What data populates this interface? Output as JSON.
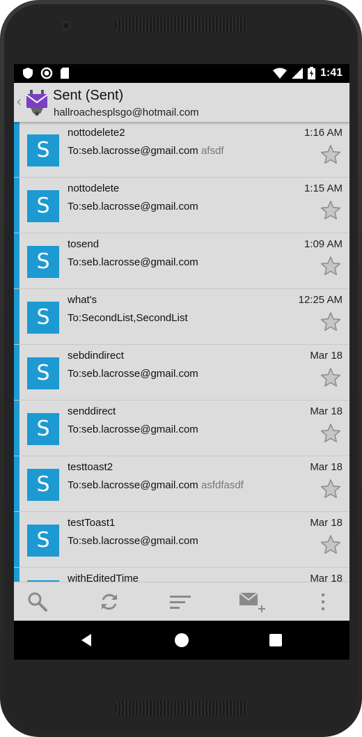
{
  "status_bar": {
    "time": "1:41"
  },
  "app_bar": {
    "title": "Sent (Sent)",
    "account": "hallroachesplsgo@hotmail.com"
  },
  "colors": {
    "accent": "#1d9ad1",
    "list_bg": "#dcdcdc"
  },
  "messages": [
    {
      "avatar": "S",
      "subject": "nottodelete2",
      "to": "To:seb.lacrosse@gmail.com",
      "snippet": "afsdf",
      "time": "1:16 AM",
      "starred": false
    },
    {
      "avatar": "S",
      "subject": "nottodelete",
      "to": "To:seb.lacrosse@gmail.com",
      "snippet": "",
      "time": "1:15 AM",
      "starred": false
    },
    {
      "avatar": "S",
      "subject": "tosend",
      "to": "To:seb.lacrosse@gmail.com",
      "snippet": "",
      "time": "1:09 AM",
      "starred": false
    },
    {
      "avatar": "S",
      "subject": "what's",
      "to": "To:SecondList,SecondList",
      "snippet": "",
      "time": "12:25 AM",
      "starred": false
    },
    {
      "avatar": "S",
      "subject": "sebdindirect",
      "to": "To:seb.lacrosse@gmail.com",
      "snippet": "",
      "time": "Mar 18",
      "starred": false
    },
    {
      "avatar": "S",
      "subject": "senddirect",
      "to": "To:seb.lacrosse@gmail.com",
      "snippet": "",
      "time": "Mar 18",
      "starred": false
    },
    {
      "avatar": "S",
      "subject": "testtoast2",
      "to": "To:seb.lacrosse@gmail.com",
      "snippet": "asfdfasdf",
      "time": "Mar 18",
      "starred": false
    },
    {
      "avatar": "S",
      "subject": "testToast1",
      "to": "To:seb.lacrosse@gmail.com",
      "snippet": "",
      "time": "Mar 18",
      "starred": false
    },
    {
      "avatar": "S",
      "subject": "withEditedTime",
      "to": "",
      "snippet": "",
      "time": "Mar 18",
      "starred": false
    }
  ],
  "toolbar": {
    "icons": [
      "search-icon",
      "refresh-icon",
      "sort-icon",
      "compose-icon",
      "overflow-menu-icon"
    ]
  },
  "nav_bar": {
    "icons": [
      "back-icon",
      "home-icon",
      "recents-icon"
    ]
  }
}
